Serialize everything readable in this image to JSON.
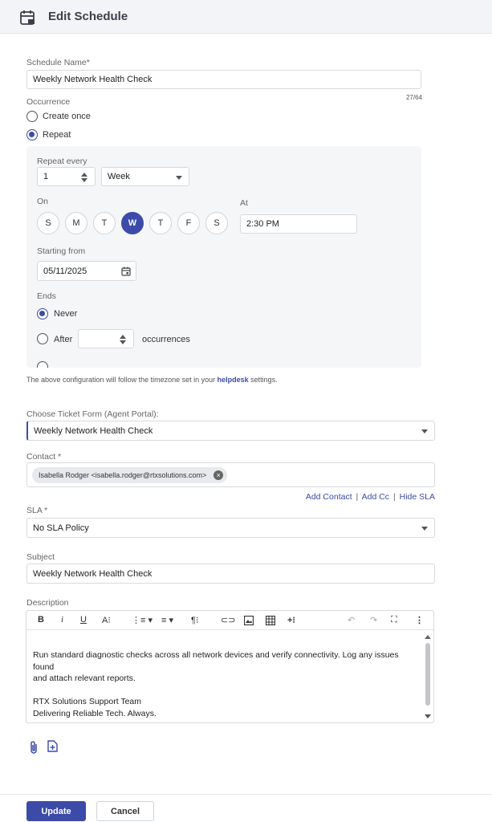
{
  "header": {
    "title": "Edit Schedule",
    "icon": "calendar-edit-icon"
  },
  "schedule_name": {
    "label": "Schedule Name*",
    "value": "Weekly Network Health Check",
    "counter": "27/64"
  },
  "occurrence": {
    "label": "Occurrence",
    "options": [
      {
        "label": "Create once",
        "checked": false
      },
      {
        "label": "Repeat",
        "checked": true
      }
    ]
  },
  "repeat": {
    "every_label": "Repeat every",
    "every_value": "1",
    "unit": "Week",
    "on_label": "On",
    "days": [
      "S",
      "M",
      "T",
      "W",
      "T",
      "F",
      "S"
    ],
    "active_day": "W",
    "at_label": "At",
    "time": "2:30 PM",
    "starting_label": "Starting from",
    "start_date": "05/11/2025",
    "ends_label": "Ends",
    "ends_never": "Never",
    "ends_after": "After",
    "occurrences_suffix": "occurrences"
  },
  "note": {
    "text": "The above configuration will follow the timezone set in your ",
    "link": "helpdesk",
    "suffix": " settings."
  },
  "ticket_form": {
    "label": "Choose Ticket Form (Agent Portal):",
    "value": "Weekly Network Health Check"
  },
  "contact": {
    "label": "Contact *",
    "chip": "Isabella Rodger <isabella.rodger@rtxsolutions.com>",
    "links": {
      "add_contact": "Add Contact",
      "add_cc": "Add Cc",
      "hide_sla": "Hide SLA"
    }
  },
  "sla": {
    "label": "SLA *",
    "value": "No SLA Policy"
  },
  "subject": {
    "label": "Subject",
    "value": "Weekly Network Health Check"
  },
  "description": {
    "label": "Description",
    "lines": [
      "Run standard diagnostic checks across all network devices and verify connectivity. Log any issues found",
      "and attach relevant reports.",
      "",
      "RTX Solutions Support Team",
      "Delivering Reliable Tech. Always."
    ]
  },
  "footer": {
    "update": "Update",
    "cancel": "Cancel"
  },
  "colors": {
    "accent": "#3c4ba8",
    "header_bg": "#f3f4f7",
    "panel_bg": "#f5f6f8"
  }
}
